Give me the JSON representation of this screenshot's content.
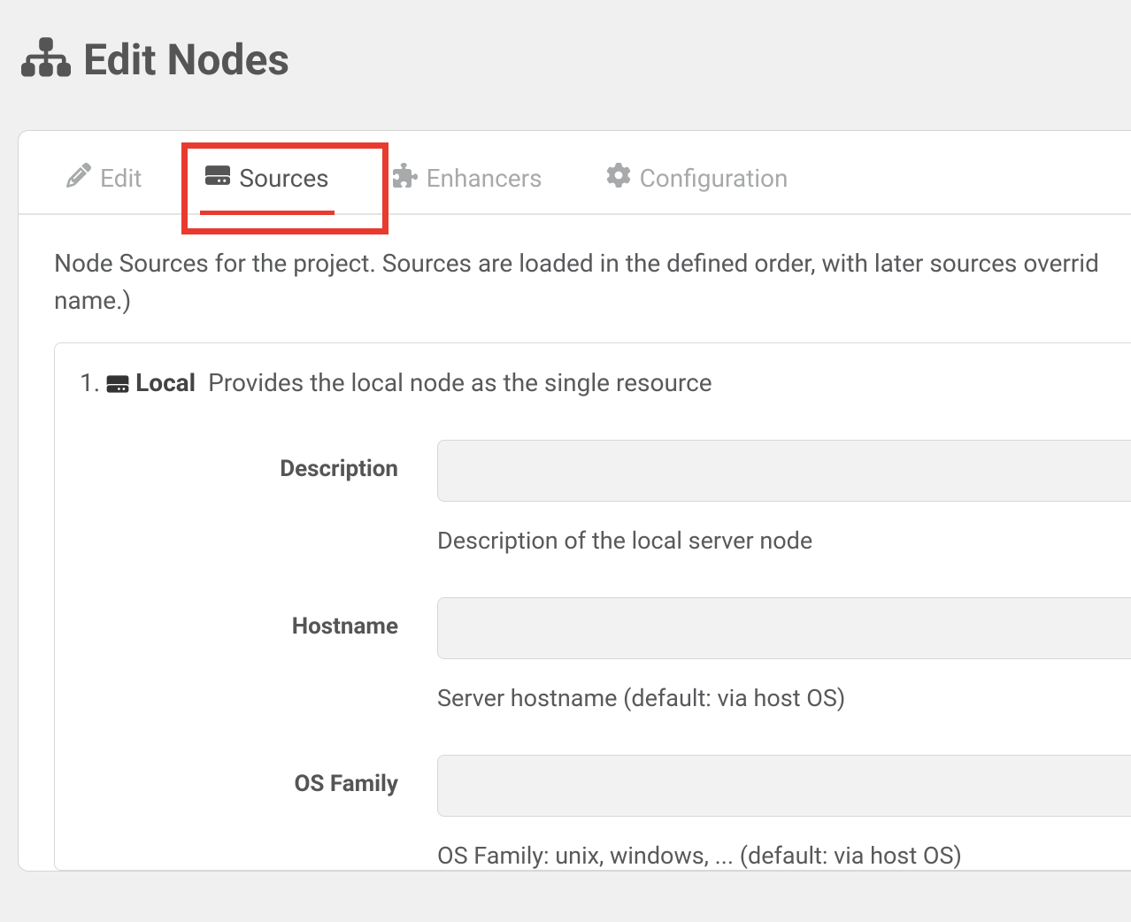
{
  "header": {
    "title": "Edit Nodes"
  },
  "tabs": {
    "edit": "Edit",
    "sources": "Sources",
    "enhancers": "Enhancers",
    "configuration": "Configuration"
  },
  "description": "Node Sources for the project. Sources are loaded in the defined order, with later sources overrid name.)",
  "source": {
    "number": "1.",
    "name": "Local",
    "desc": "Provides the local node as the single resource",
    "fields": {
      "description": {
        "label": "Description",
        "value": "",
        "help": "Description of the local server node"
      },
      "hostname": {
        "label": "Hostname",
        "value": "",
        "help": "Server hostname (default: via host OS)"
      },
      "osfamily": {
        "label": "OS Family",
        "value": "",
        "help": "OS Family: unix, windows, ... (default: via host OS)"
      }
    }
  }
}
